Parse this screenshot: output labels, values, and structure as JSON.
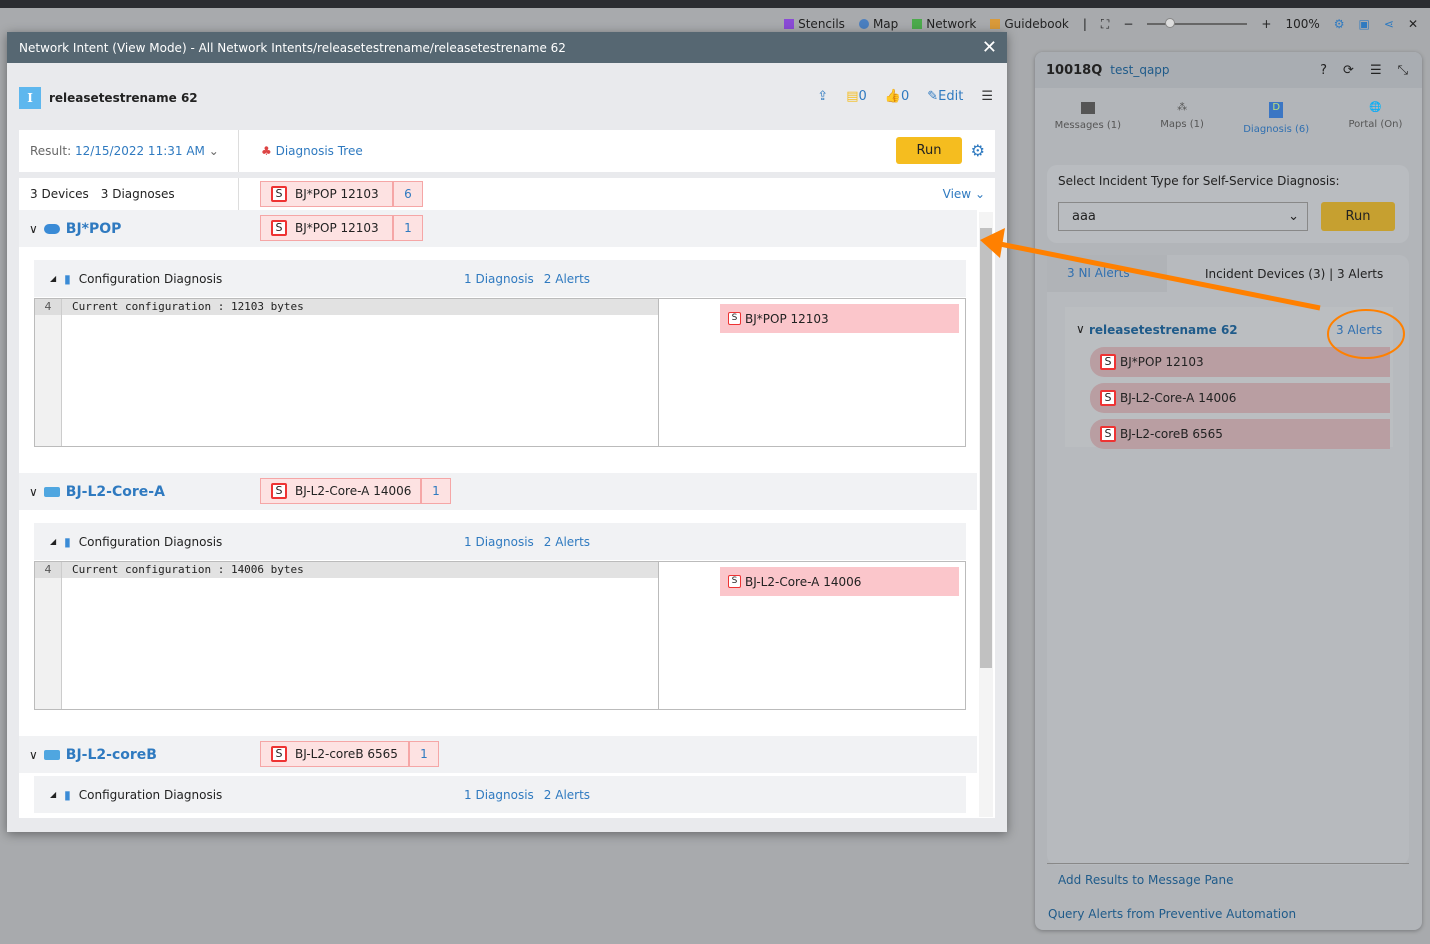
{
  "toolbar": {
    "stencils": "Stencils",
    "map": "Map",
    "network": "Network",
    "guidebook": "Guidebook",
    "zoom": "100%"
  },
  "dialog": {
    "title": "Network Intent (View Mode) - All Network Intents/releasetestrename/releasetestrename 62",
    "name": "releasetestrename 62",
    "note_count": "0",
    "like_count": "0",
    "edit": "Edit",
    "result_label": "Result:",
    "result_value": "12/15/2022 11:31 AM",
    "diagnosis_tree": "Diagnosis Tree",
    "run": "Run",
    "devices_count": "3 Devices",
    "diagnoses_count": "3 Diagnoses",
    "summary_tag": "BJ*POP 12103",
    "summary_count": "6",
    "view": "View",
    "devices": [
      {
        "name": "BJ*POP",
        "tag": "BJ*POP 12103",
        "count": "1",
        "diag": "Configuration Diagnosis",
        "diag_count": "1 Diagnosis",
        "alerts": "2 Alerts",
        "line_no": "4",
        "code": "Current configuration : 12103 bytes",
        "alert": "BJ*POP 12103"
      },
      {
        "name": "BJ-L2-Core-A",
        "tag": "BJ-L2-Core-A 14006",
        "count": "1",
        "diag": "Configuration Diagnosis",
        "diag_count": "1 Diagnosis",
        "alerts": "2 Alerts",
        "line_no": "4",
        "code": "Current configuration : 14006 bytes",
        "alert": "BJ-L2-Core-A 14006"
      },
      {
        "name": "BJ-L2-coreB",
        "tag": "BJ-L2-coreB 6565",
        "count": "1",
        "diag": "Configuration Diagnosis",
        "diag_count": "1 Diagnosis",
        "alerts": "2 Alerts"
      }
    ]
  },
  "panel": {
    "id": "10018Q",
    "user": "test_qapp",
    "tabs": [
      "Messages (1)",
      "Maps (1)",
      "Diagnosis (6)",
      "Portal (On)"
    ],
    "incident_label": "Select Incident Type for Self-Service Diagnosis:",
    "incident_value": "aaa",
    "run": "Run",
    "ni_alerts": "3 NI Alerts",
    "incident_devices": "Incident Devices (3)",
    "incident_alerts": "3 Alerts",
    "group": "releasetestrename 62",
    "group_alerts": "3 Alerts",
    "items": [
      "BJ*POP 12103",
      "BJ-L2-Core-A 14006",
      "BJ-L2-coreB 6565"
    ],
    "add_results": "Add Results to Message Pane",
    "query_alerts": "Query Alerts from Preventive Automation"
  },
  "colors": {
    "accent": "#2f7ac0",
    "run": "#f5bd1f",
    "annotation": "#ff8000"
  }
}
